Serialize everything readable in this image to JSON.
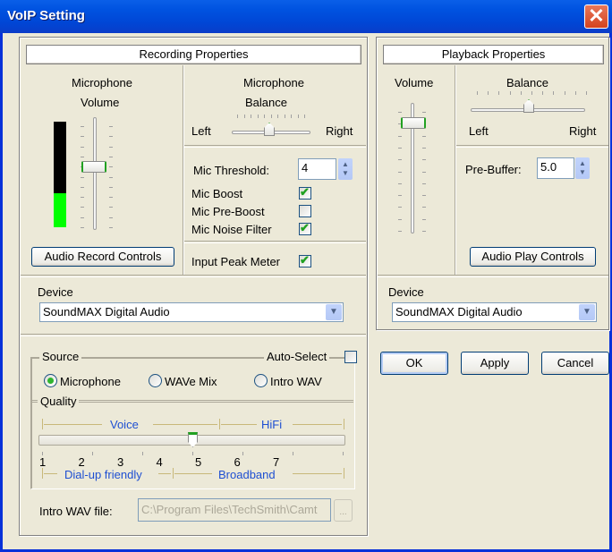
{
  "window": {
    "title": "VoIP Setting",
    "close_icon": "close-icon"
  },
  "recording": {
    "header": "Recording Properties",
    "volume": {
      "label_line1": "Microphone",
      "label_line2": "Volume",
      "level_meter_fraction": 0.33,
      "slider_fraction": 0.55
    },
    "balance": {
      "label_line1": "Microphone",
      "label_line2": "Balance",
      "left": "Left",
      "right": "Right",
      "position_fraction": 0.5
    },
    "threshold": {
      "label": "Mic Threshold:",
      "value": "4"
    },
    "options": [
      {
        "label": "Mic Boost",
        "checked": true
      },
      {
        "label": "Mic Pre-Boost",
        "checked": false
      },
      {
        "label": "Mic Noise Filter",
        "checked": true
      }
    ],
    "peak_meter": {
      "label": "Input Peak Meter",
      "checked": true
    },
    "controls_button": "Audio Record Controls",
    "device": {
      "label": "Device",
      "value": "SoundMAX Digital Audio"
    },
    "source": {
      "label": "Source",
      "auto_select": {
        "label": "Auto-Select",
        "checked": false
      },
      "options": [
        {
          "label": "Microphone",
          "selected": true
        },
        {
          "label": "WAVe Mix",
          "selected": false
        },
        {
          "label": "Intro WAV",
          "selected": false
        }
      ]
    },
    "quality": {
      "label": "Quality",
      "top_ranges": [
        "Voice",
        "HiFi"
      ],
      "ticks": [
        "1",
        "2",
        "3",
        "4",
        "5",
        "6",
        "7"
      ],
      "bottom_ranges": [
        "Dial-up friendly",
        "Broadband"
      ],
      "value": 5
    },
    "intro_wav": {
      "label": "Intro WAV file:",
      "value": "C:\\Program Files\\TechSmith\\Camt",
      "browse": "..."
    }
  },
  "playback": {
    "header": "Playback Properties",
    "volume": {
      "label": "Volume",
      "slider_fraction": 0.12
    },
    "balance": {
      "label": "Balance",
      "left": "Left",
      "right": "Right",
      "position_fraction": 0.5
    },
    "prebuffer": {
      "label": "Pre-Buffer:",
      "value": "5.0"
    },
    "controls_button": "Audio Play Controls",
    "device": {
      "label": "Device",
      "value": "SoundMAX Digital Audio"
    }
  },
  "buttons": {
    "ok": "OK",
    "apply": "Apply",
    "cancel": "Cancel"
  }
}
